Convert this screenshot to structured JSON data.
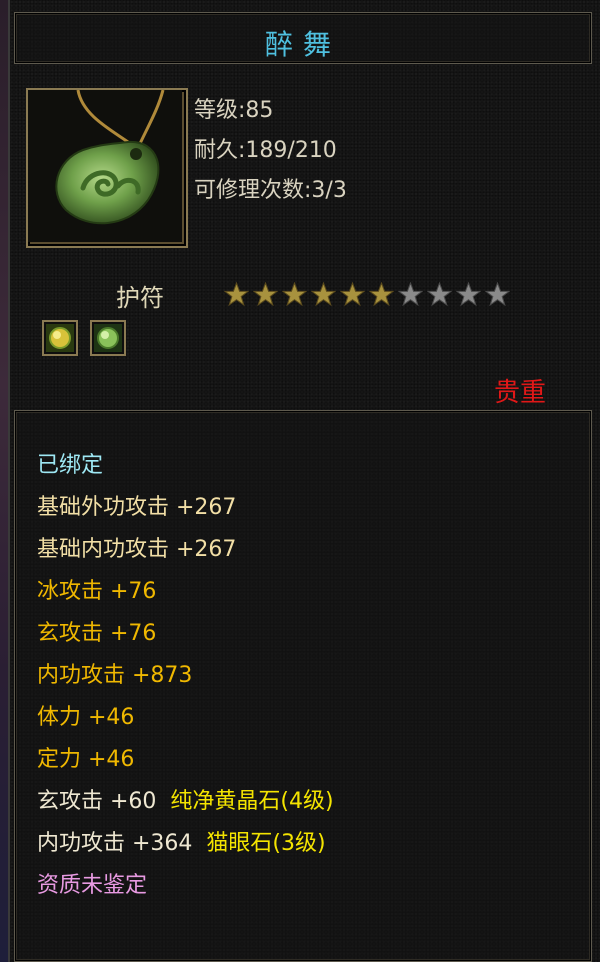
{
  "item": {
    "name": "醉舞",
    "level_text": "等级:85",
    "durability_text": "耐久:189/210",
    "repair_text": "可修理次数:3/3",
    "type": "护符",
    "stars_filled": 6,
    "stars_total": 10,
    "rarity": "贵重"
  },
  "attributes": {
    "bound": "已绑定",
    "base_ext_attack": "基础外功攻击 +267",
    "base_int_attack": "基础内功攻击 +267",
    "ice_attack": "冰攻击 +76",
    "mystic_attack": "玄攻击 +76",
    "internal_attack": "内功攻击 +873",
    "stamina": "体力 +46",
    "focus": "定力 +46",
    "gem1_stat": "玄攻击 +60",
    "gem1_name": "纯净黄晶石(4级)",
    "gem2_stat": "内功攻击 +364",
    "gem2_name": "猫眼石(3级)",
    "aptitude": "资质未鉴定"
  },
  "colors": {
    "title": "#4fc0e0",
    "rarity": "#e01818",
    "bound": "#9ee8f4",
    "base_stats": "#f2dfa6",
    "bonus_stats": "#f0b800",
    "gem_name": "#f4e400",
    "aptitude": "#e89ae2"
  },
  "icons": [
    "jade-amulet-icon",
    "star-icon",
    "gem-icon"
  ]
}
